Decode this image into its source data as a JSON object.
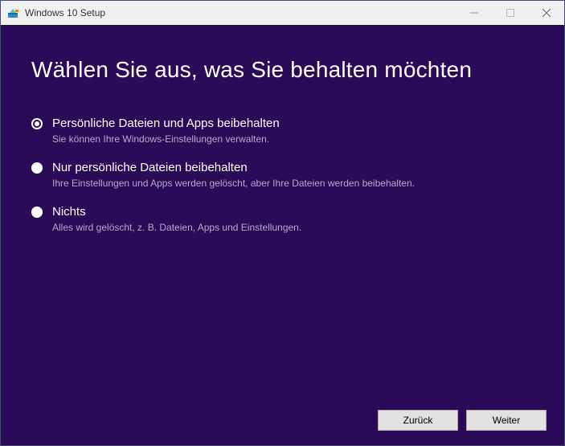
{
  "titlebar": {
    "title": "Windows 10 Setup"
  },
  "main": {
    "heading": "Wählen Sie aus, was Sie behalten möchten",
    "options": [
      {
        "label": "Persönliche Dateien und Apps beibehalten",
        "description": "Sie können Ihre Windows-Einstellungen verwalten.",
        "selected": true
      },
      {
        "label": "Nur persönliche Dateien beibehalten",
        "description": "Ihre Einstellungen und Apps werden gelöscht, aber Ihre Dateien werden beibehalten.",
        "selected": false
      },
      {
        "label": "Nichts",
        "description": "Alles wird gelöscht, z. B. Dateien, Apps und Einstellungen.",
        "selected": false
      }
    ]
  },
  "footer": {
    "back_label": "Zurück",
    "next_label": "Weiter"
  },
  "colors": {
    "background": "#2b0a57",
    "button_bg": "#e1e1e1"
  }
}
